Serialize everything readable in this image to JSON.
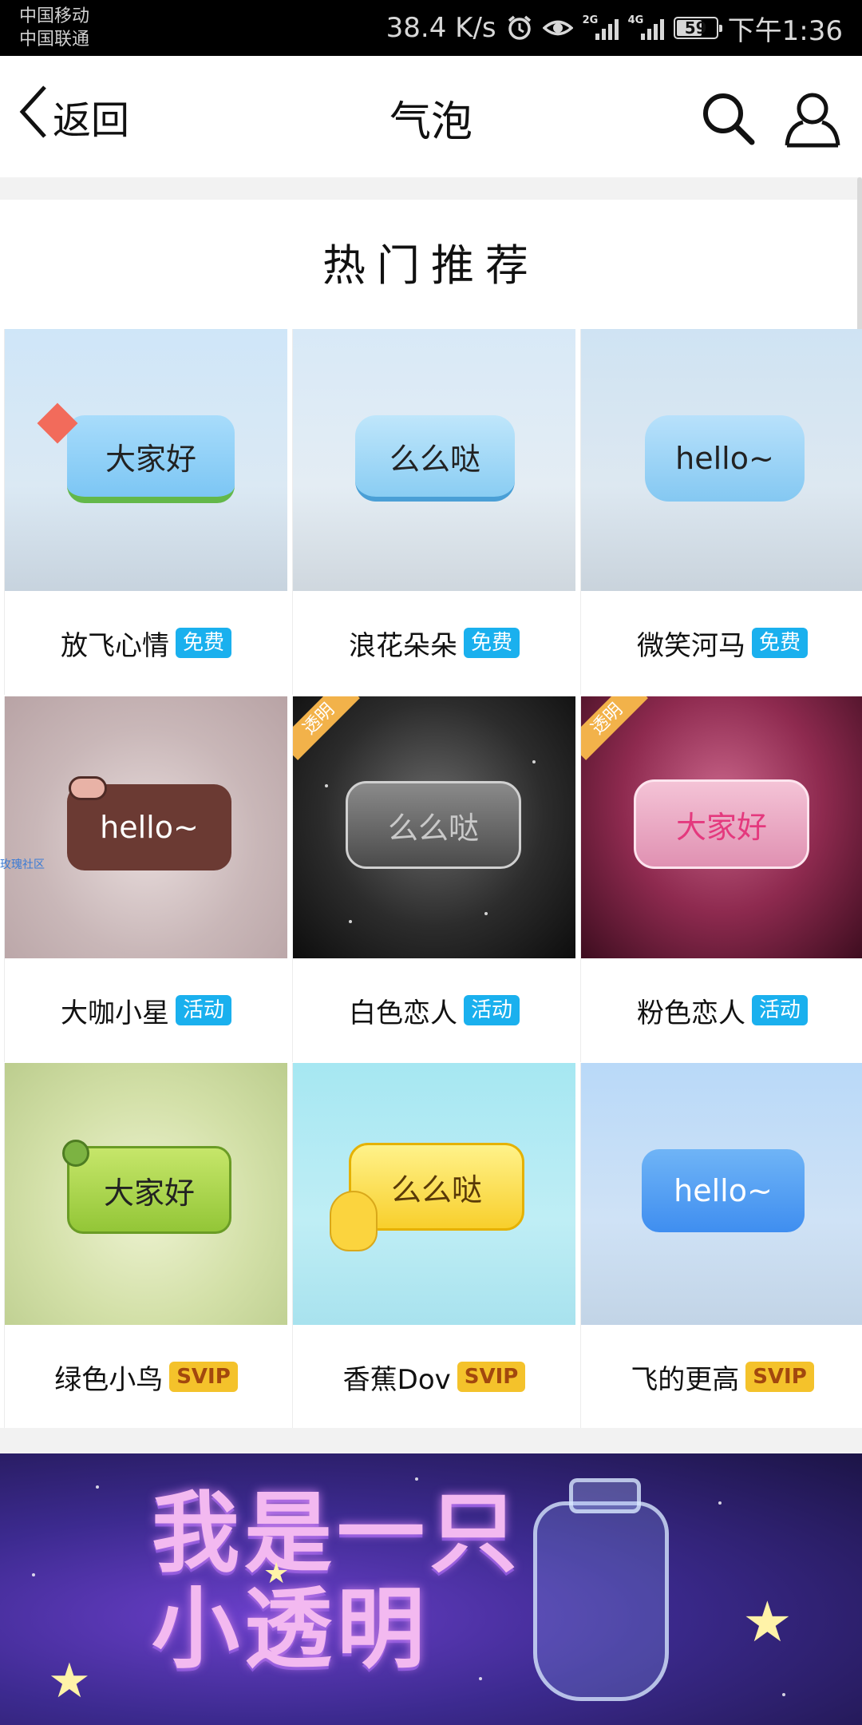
{
  "status_bar": {
    "carrier_1": "中国移动",
    "carrier_2": "中国联通",
    "net_speed": "38.4 K/s",
    "signal_1_type": "2G",
    "signal_2_type": "4G",
    "battery": "59",
    "time": "下午1:36"
  },
  "nav": {
    "back_label": "返回",
    "title": "气泡"
  },
  "section": {
    "title": "热门推荐"
  },
  "items": [
    {
      "bubble_text": "大家好",
      "name": "放飞心情",
      "badge": "免费",
      "badge_type": "free",
      "corner": ""
    },
    {
      "bubble_text": "么么哒",
      "name": "浪花朵朵",
      "badge": "免费",
      "badge_type": "free",
      "corner": ""
    },
    {
      "bubble_text": "hello~",
      "name": "微笑河马",
      "badge": "免费",
      "badge_type": "free",
      "corner": ""
    },
    {
      "bubble_text": "hello~",
      "name": "大咖小星",
      "badge": "活动",
      "badge_type": "event",
      "corner": ""
    },
    {
      "bubble_text": "么么哒",
      "name": "白色恋人",
      "badge": "活动",
      "badge_type": "event",
      "corner": "透明"
    },
    {
      "bubble_text": "大家好",
      "name": "粉色恋人",
      "badge": "活动",
      "badge_type": "event",
      "corner": "透明"
    },
    {
      "bubble_text": "大家好",
      "name": "绿色小鸟",
      "badge": "SVIP",
      "badge_type": "svip",
      "corner": ""
    },
    {
      "bubble_text": "么么哒",
      "name": "香蕉Dov",
      "badge": "SVIP",
      "badge_type": "svip",
      "corner": ""
    },
    {
      "bubble_text": "hello~",
      "name": "飞的更高",
      "badge": "SVIP",
      "badge_type": "svip",
      "corner": ""
    }
  ],
  "side_watermark": "玫瑰社区",
  "banner": {
    "text": "我是一只小透明"
  },
  "colors": {
    "badge_blue": "#1ab0ee",
    "badge_svip": "#f4c22b"
  }
}
